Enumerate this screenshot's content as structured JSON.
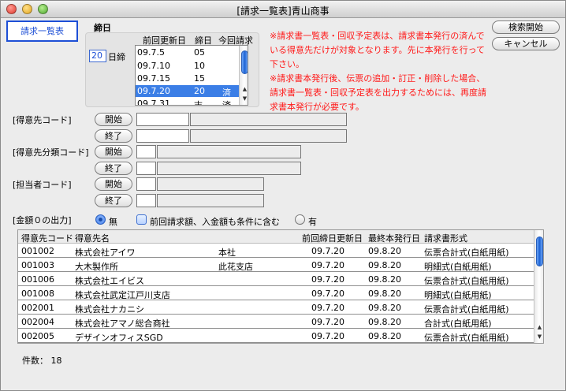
{
  "window": {
    "title": "[請求一覧表]青山商事"
  },
  "tab": {
    "label": "請求一覧表"
  },
  "closing": {
    "heading": "締日",
    "day_value": "20",
    "day_suffix": "日締",
    "columns": [
      "前回更新日",
      "締日",
      "今回請求"
    ],
    "rows": [
      {
        "date": "09.7.5",
        "day": "05",
        "status": ""
      },
      {
        "date": "09.7.10",
        "day": "10",
        "status": ""
      },
      {
        "date": "09.7.15",
        "day": "15",
        "status": ""
      },
      {
        "date": "09.7.20",
        "day": "20",
        "status": "済"
      },
      {
        "date": "09.7.31",
        "day": "末",
        "status": "済"
      }
    ]
  },
  "notice": {
    "lines": [
      "※請求書一覧表・回収予定表は、請求書本発行の済んで",
      "いる得意先だけが対象となります。先に本発行を行って",
      "下さい。",
      "※請求書本発行後、伝票の追加・訂正・削除した場合、",
      "請求書一覧表・回収予定表を出力するためには、再度請",
      "求書本発行が必要です。"
    ]
  },
  "buttons": {
    "search": "検索開始",
    "cancel": "キャンセル",
    "start": "開始",
    "end": "終了"
  },
  "filters": {
    "customer_code": "[得意先コード]",
    "customer_category": "[得意先分類コード]",
    "staff_code": "[担当者コード]"
  },
  "zero_output": {
    "label": "[金額０の出力]",
    "option_none": "無",
    "checkbox_label": "前回請求額、入金額も条件に含む",
    "option_yes": "有"
  },
  "table": {
    "headers": [
      "得意先コード",
      "得意先名",
      "前回締日更新日",
      "最終本発行日",
      "請求書形式"
    ],
    "rows": [
      {
        "code": "001002",
        "name": "株式会社アイワ",
        "branch": "本社",
        "prev": "09.7.20",
        "last": "09.8.20",
        "format": "伝票合計式(白紙用紙)"
      },
      {
        "code": "001003",
        "name": "大木製作所",
        "branch": "此花支店",
        "prev": "09.7.20",
        "last": "09.8.20",
        "format": "明細式(白紙用紙)"
      },
      {
        "code": "001006",
        "name": "株式会社エイビス",
        "branch": "",
        "prev": "09.7.20",
        "last": "09.8.20",
        "format": "伝票合計式(白紙用紙)"
      },
      {
        "code": "001008",
        "name": "株式会社武定江戸川支店",
        "branch": "",
        "prev": "09.7.20",
        "last": "09.8.20",
        "format": "明細式(白紙用紙)"
      },
      {
        "code": "002001",
        "name": "株式会社ナカニシ",
        "branch": "",
        "prev": "09.7.20",
        "last": "09.8.20",
        "format": "伝票合計式(白紙用紙)"
      },
      {
        "code": "002004",
        "name": "株式会社アマノ総合商社",
        "branch": "",
        "prev": "09.7.20",
        "last": "09.8.20",
        "format": "合計式(白紙用紙)"
      },
      {
        "code": "002005",
        "name": "デザインオフィスSGD",
        "branch": "",
        "prev": "09.7.20",
        "last": "09.8.20",
        "format": "伝票合計式(白紙用紙)"
      }
    ]
  },
  "count": {
    "label": "件数：",
    "value": "18"
  }
}
